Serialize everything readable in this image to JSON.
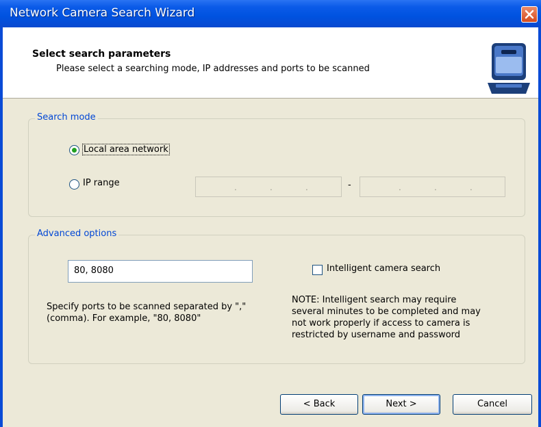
{
  "window": {
    "title": "Network Camera Search Wizard"
  },
  "header": {
    "title": "Select search parameters",
    "subtitle": "Please select a searching mode, IP addresses and ports to be scanned"
  },
  "search_mode": {
    "legend": "Search mode",
    "local_area_label": "Local area network",
    "local_area_selected": true,
    "ip_range_label": "IP range",
    "ip_range_selected": false,
    "ip_range_separator": "-"
  },
  "advanced": {
    "legend": "Advanced options",
    "ports_value": "80, 8080",
    "intelligent_search_label": "Intelligent camera search",
    "intelligent_search_checked": false,
    "ports_help_line1": "Specify ports to be scanned separated by \",\"",
    "ports_help_line2": "(comma). For example, \"80, 8080\"",
    "note_line1": "NOTE: Intelligent search may require",
    "note_line2": "several minutes to be completed and may",
    "note_line3": "not work properly if access to camera is",
    "note_line4": "restricted by username and password"
  },
  "buttons": {
    "back": "< Back",
    "next": "Next >",
    "cancel": "Cancel"
  },
  "colors": {
    "titlebar": "#0052e0",
    "legend_text": "#0046d5",
    "radio_dot": "#21a121",
    "dialog_bg": "#ece9d8"
  }
}
